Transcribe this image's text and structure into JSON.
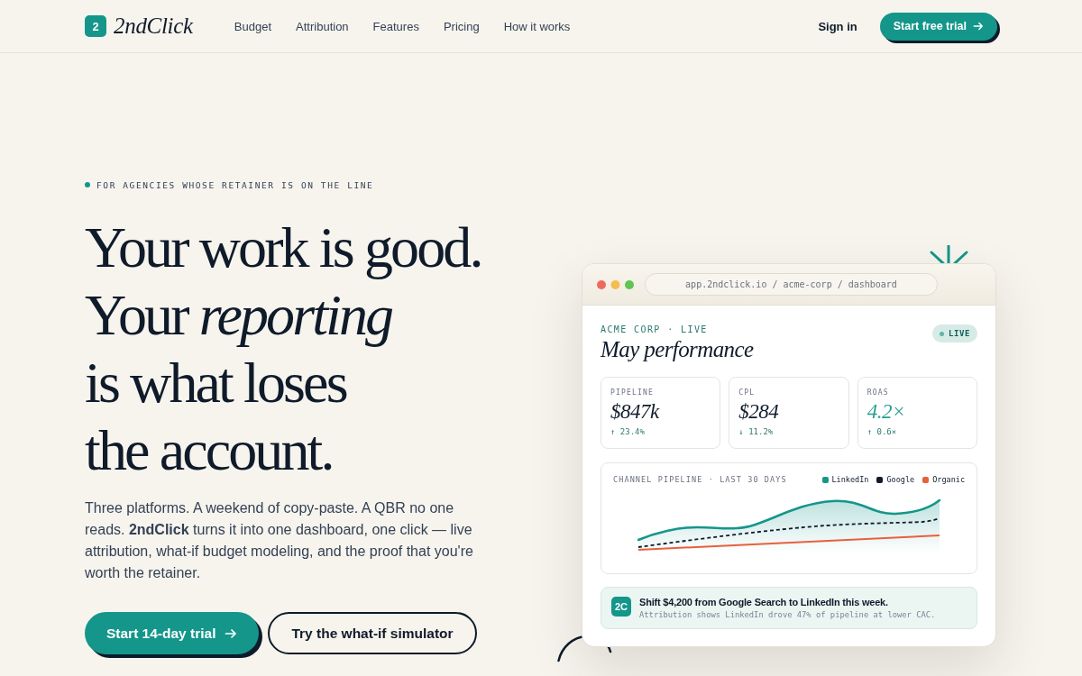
{
  "header": {
    "logo": {
      "mark": "2",
      "name": "2ndClick"
    },
    "nav": [
      {
        "label": "Budget"
      },
      {
        "label": "Attribution"
      },
      {
        "label": "Features"
      },
      {
        "label": "Pricing"
      },
      {
        "label": "How it works"
      }
    ],
    "sign_in": "Sign in",
    "cta": "Start free trial"
  },
  "hero": {
    "eyebrow": "FOR AGENCIES WHOSE RETAINER IS ON THE LINE",
    "headline": "Your work is good.\nYour *reporting*\nis what loses\nthe account.",
    "body": "Three platforms. A weekend of copy-paste. A QBR no one reads. **2ndClick** turns it into one dashboard, one click — live attribution, what-if budget modeling, and the proof that you're worth the retainer.",
    "buttons": [
      {
        "label": "Start 14-day trial",
        "kind": "primary"
      },
      {
        "label": "Try the what-if simulator",
        "kind": "secondary"
      }
    ]
  },
  "dashboard": {
    "url": "app.2ndclick.io / acme-corp / dashboard",
    "eyebrow": "ACME CORP · LIVE",
    "title": "May performance",
    "status_badge": "LIVE",
    "kpis": [
      {
        "label": "PIPELINE",
        "value": "$847k",
        "delta": "↑ 23.4%",
        "highlight": false
      },
      {
        "label": "CPL",
        "value": "$284",
        "delta": "↓ 11.2%",
        "highlight": false
      },
      {
        "label": "ROAS",
        "value": "4.2×",
        "delta": "↑ 0.6×",
        "highlight": true
      }
    ],
    "chart": {
      "title": "CHANNEL PIPELINE · LAST 30 DAYS",
      "legend": [
        {
          "label": "LinkedIn",
          "color": "#14968a"
        },
        {
          "label": "Google",
          "color": "#0f1b2a"
        },
        {
          "label": "Organic",
          "color": "#e8603c"
        }
      ]
    },
    "insight": {
      "badge": "2C",
      "title": "Shift $4,200 from Google Search to LinkedIn this week.",
      "text": "Attribution shows LinkedIn drove 47% of pipeline at lower CAC."
    }
  }
}
